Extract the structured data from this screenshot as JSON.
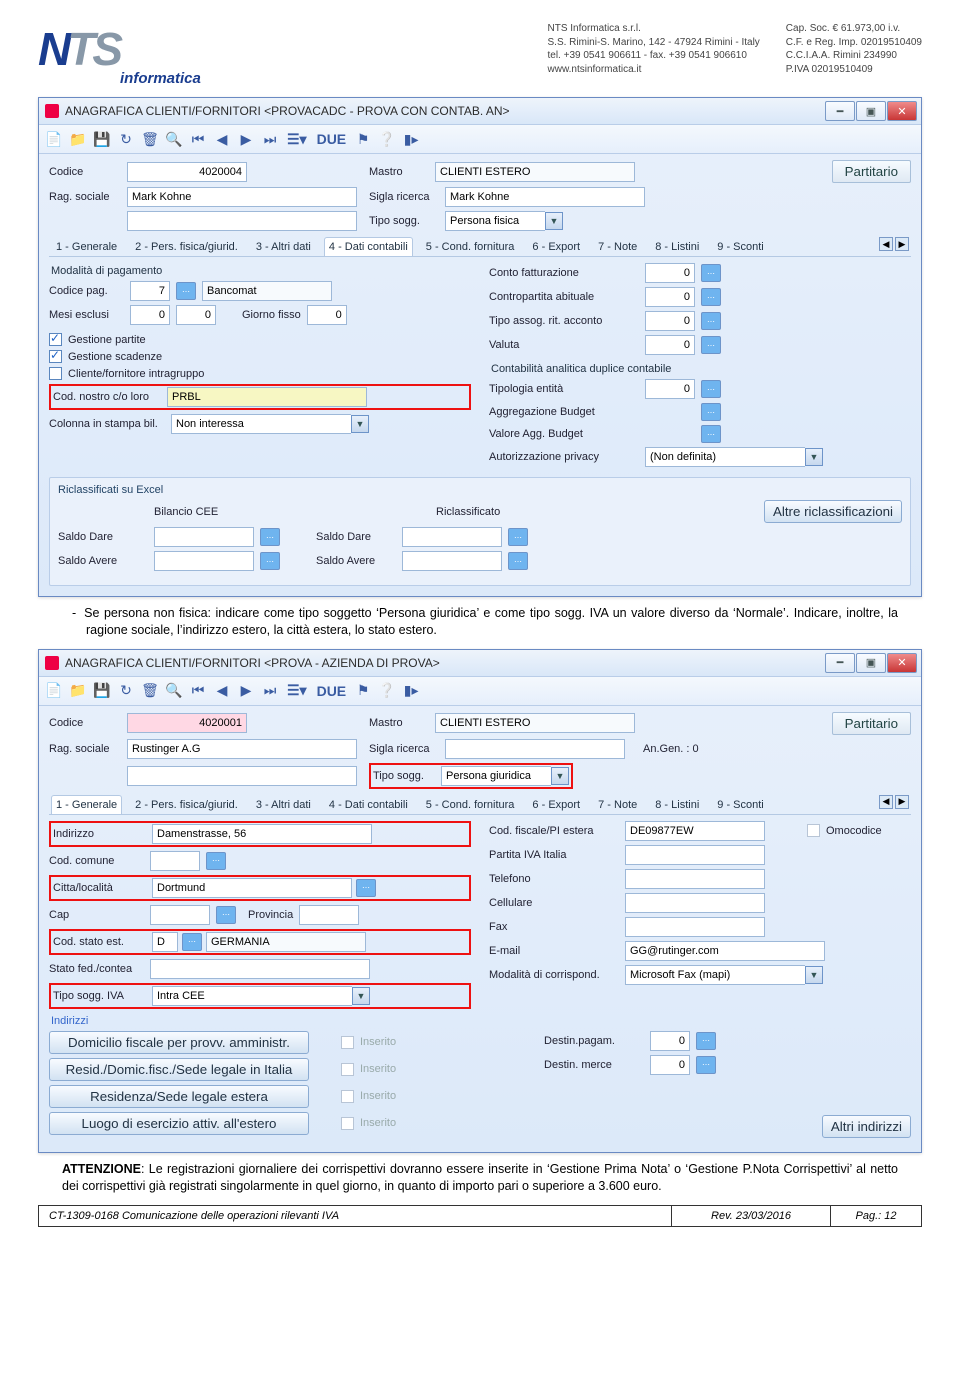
{
  "header": {
    "company_block": "NTS Informatica s.r.l.\nS.S. Rimini-S. Marino, 142 - 47924 Rimini - Italy\ntel. +39 0541 906611 - fax. +39 0541 906610\nwww.ntsinformatica.it",
    "legal_block": "Cap. Soc. € 61.973,00 i.v.\nC.F. e Reg. Imp. 02019510409\nC.C.I.A.A. Rimini 234990\nP.IVA 02019510409",
    "logo_sub": "informatica"
  },
  "win1": {
    "title": "ANAGRAFICA CLIENTI/FORNITORI <PROVACADC - PROVA CON CONTAB. AN>",
    "codice_lbl": "Codice",
    "codice_val": "4020004",
    "mastro_lbl": "Mastro",
    "mastro_val": "CLIENTI ESTERO",
    "partitario_btn": "Partitario",
    "rag_lbl": "Rag. sociale",
    "rag_val": "Mark Kohne",
    "sigla_lbl": "Sigla ricerca",
    "sigla_val": "Mark Kohne",
    "tipo_lbl": "Tipo sogg.",
    "tipo_val": "Persona fisica",
    "tabs": [
      "1 - Generale",
      "2 - Pers. fisica/giurid.",
      "3 - Altri dati",
      "4 - Dati contabili",
      "5 - Cond. fornitura",
      "6 - Export",
      "7 - Note",
      "8 - Listini",
      "9 - Sconti"
    ],
    "modpag_title": "Modalità di pagamento",
    "codpag_lbl": "Codice pag.",
    "codpag_val": "7",
    "codpag_desc": "Bancomat",
    "mesi_lbl": "Mesi esclusi",
    "mesi_v1": "0",
    "mesi_v2": "0",
    "gfisso_lbl": "Giorno fisso",
    "gfisso_val": "0",
    "chk1": "Gestione partite",
    "chk2": "Gestione scadenze",
    "chk3": "Cliente/fornitore intragruppo",
    "codnostro_lbl": "Cod. nostro c/o loro",
    "codnostro_val": "PRBL",
    "colstampa_lbl": "Colonna in stampa bil.",
    "colstampa_val": "Non interessa",
    "contofatt_lbl": "Conto fatturazione",
    "contofatt_val": "0",
    "contrab_lbl": "Contropartita abituale",
    "contrab_val": "0",
    "tipoassog_lbl": "Tipo assog. rit. acconto",
    "tipoassog_val": "0",
    "valuta_lbl": "Valuta",
    "valuta_val": "0",
    "cadc_title": "Contabilità analitica duplice contabile",
    "tipent_lbl": "Tipologia entità",
    "tipent_val": "0",
    "aggbudget_lbl": "Aggregazione Budget",
    "valagg_lbl": "Valore Agg. Budget",
    "autpriv_lbl": "Autorizzazione privacy",
    "autpriv_val": "(Non definita)",
    "riclass_title": "Riclassificati su Excel",
    "bilcee_lbl": "Bilancio CEE",
    "riclass_lbl": "Riclassificato",
    "sdare_lbl": "Saldo Dare",
    "savere_lbl": "Saldo Avere",
    "altrericl_btn": "Altre riclassificazioni"
  },
  "para1": "Se persona non fisica: indicare come tipo soggetto ‘Persona giuridica’ e come tipo sogg. IVA un valore diverso da ‘Normale’. Indicare, inoltre, la ragione sociale, l’indirizzo estero, la città estera, lo stato estero.",
  "win2": {
    "title": "ANAGRAFICA CLIENTI/FORNITORI <PROVA - AZIENDA DI PROVA>",
    "codice_lbl": "Codice",
    "codice_val": "4020001",
    "mastro_lbl": "Mastro",
    "mastro_val": "CLIENTI ESTERO",
    "partitario_btn": "Partitario",
    "rag_lbl": "Rag. sociale",
    "rag_val": "Rustinger A.G",
    "sigla_lbl": "Sigla ricerca",
    "angen_lbl": "An.Gen. : 0",
    "tipo_lbl": "Tipo sogg.",
    "tipo_val": "Persona giuridica",
    "tabs": [
      "1 - Generale",
      "2 - Pers. fisica/giurid.",
      "3 - Altri dati",
      "4 - Dati contabili",
      "5 - Cond. fornitura",
      "6 - Export",
      "7 - Note",
      "8 - Listini",
      "9 - Sconti"
    ],
    "indir_lbl": "Indirizzo",
    "indir_val": "Damenstrasse, 56",
    "codfisc_lbl": "Cod. fiscale/PI estera",
    "codfisc_val": "DE09877EW",
    "omocod_lbl": "Omocodice",
    "codcom_lbl": "Cod. comune",
    "piva_lbl": "Partita IVA Italia",
    "citta_lbl": "Citta/località",
    "citta_val": "Dortmund",
    "tel_lbl": "Telefono",
    "cap_lbl": "Cap",
    "prov_lbl": "Provincia",
    "cell_lbl": "Cellulare",
    "statoest_lbl": "Cod. stato est.",
    "statoest_code": "D",
    "statoest_desc": "GERMANIA",
    "fax_lbl": "Fax",
    "statofed_lbl": "Stato fed./contea",
    "email_lbl": "E-mail",
    "email_val": "GG@rutinger.com",
    "tiposogg_lbl": "Tipo sogg. IVA",
    "tiposogg_val": "Intra CEE",
    "modcorr_lbl": "Modalità di corrispond.",
    "modcorr_val": "Microsoft Fax (mapi)",
    "indirizzi_title": "Indirizzi",
    "btn1": "Domicilio fiscale per provv. amministr.",
    "btn2": "Resid./Domic.fisc./Sede legale in Italia",
    "btn3": "Residenza/Sede legale estera",
    "btn4": "Luogo di esercizio attiv. all'estero",
    "inserito": "Inserito",
    "destpag_lbl": "Destin.pagam.",
    "destpag_val": "0",
    "destmerce_lbl": "Destin. merce",
    "destmerce_val": "0",
    "altriind_btn": "Altri indirizzi"
  },
  "para2_bold": "ATTENZIONE",
  "para2": ": Le registrazioni giornaliere dei corrispettivi dovranno essere inserite in ‘Gestione Prima Nota’ o ‘Gestione P.Nota Corrispettivi’ al netto dei corrispettivi già registrati singolarmente in quel giorno, in quanto di importo pari o superiore a 3.600 euro.",
  "footer": {
    "doc": "CT-1309-0168  Comunicazione delle operazioni rilevanti IVA",
    "rev": "Rev. 23/03/2016",
    "page": "Pag.: 12"
  },
  "toolbar_due": "DUE"
}
